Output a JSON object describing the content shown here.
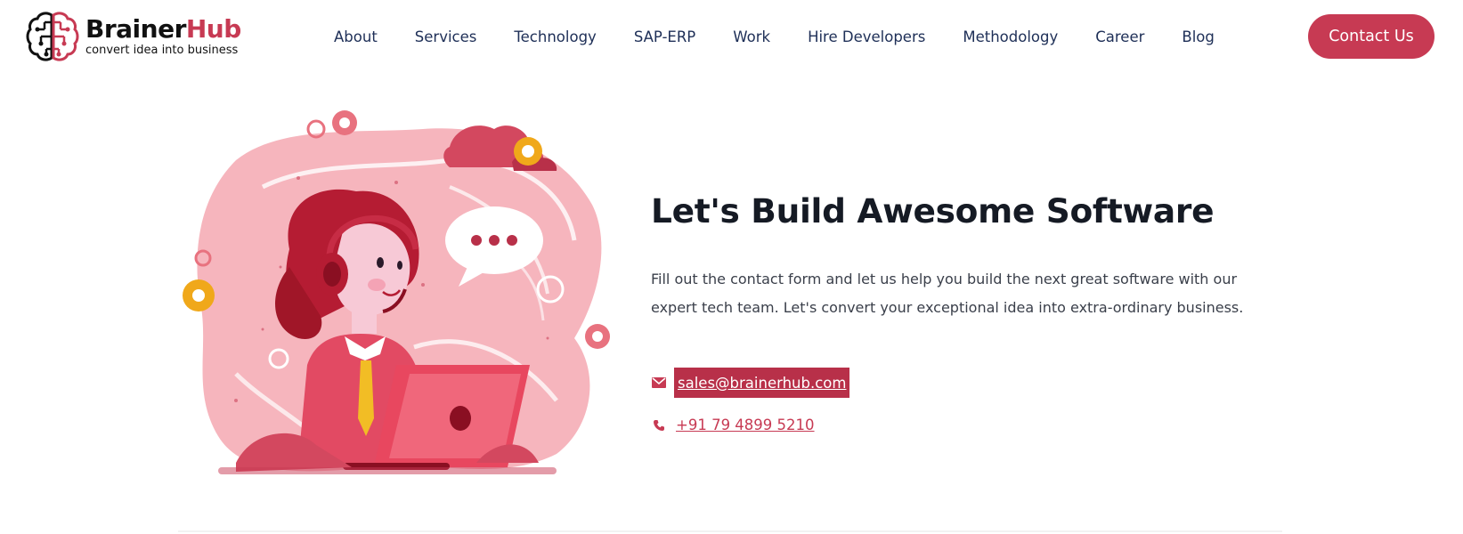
{
  "brand": {
    "name_part1": "Brainer",
    "name_part2": "Hub",
    "tagline": "convert idea into business",
    "logo_icon": "brain-circuit-icon",
    "color_dark": "#111111",
    "color_accent": "#c73a53"
  },
  "nav": {
    "items": [
      {
        "label": "About"
      },
      {
        "label": "Services"
      },
      {
        "label": "Technology"
      },
      {
        "label": "SAP-ERP"
      },
      {
        "label": "Work"
      },
      {
        "label": "Hire Developers"
      },
      {
        "label": "Methodology"
      },
      {
        "label": "Career"
      },
      {
        "label": "Blog"
      }
    ],
    "cta_label": "Contact Us"
  },
  "hero": {
    "title": "Let's Build Awesome Software",
    "description": "Fill out the contact form and let us help you build the next great software with our expert tech team. Let's convert your exceptional idea into extra-ordinary business.",
    "email": "sales@brainerhub.com",
    "phone": "+91 79 4899 5210",
    "email_icon": "envelope-icon",
    "phone_icon": "phone-icon",
    "illustration": "support-agent-with-headset-and-laptop-illustration"
  },
  "colors": {
    "accent": "#c73a53",
    "email_highlight": "#b83049",
    "nav_text": "#1e2f57",
    "heading": "#151a24"
  }
}
